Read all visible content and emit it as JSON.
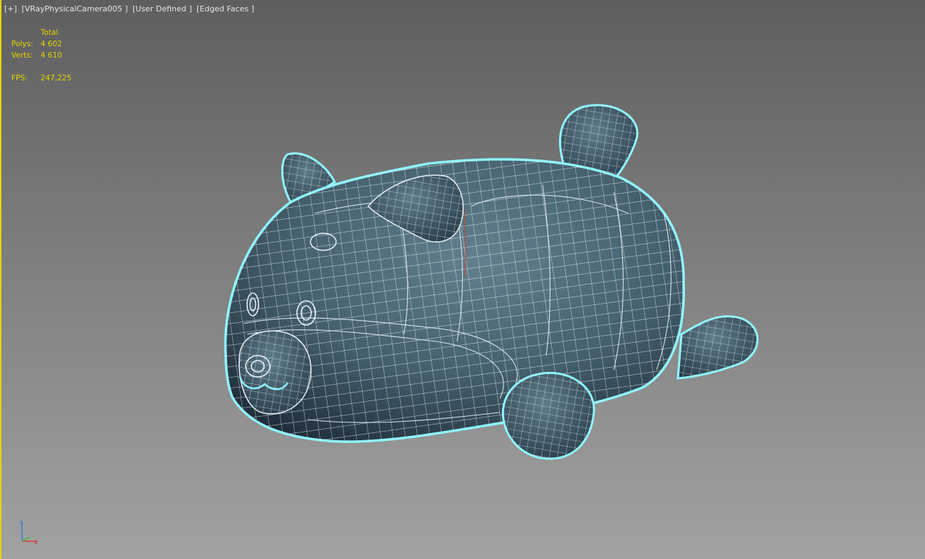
{
  "viewport": {
    "label_parts": [
      "[+]",
      "[VRayPhysicalCamera005 ]",
      "[User Defined ]",
      "[Edged Faces ]"
    ]
  },
  "stats": {
    "header": "Total",
    "polys_label": "Polys:",
    "polys_value": "4 602",
    "verts_label": "Verts:",
    "verts_value": "4 610",
    "fps_label": "FPS:",
    "fps_value": "247,225"
  },
  "axis_gizmo": {
    "z_label": "z",
    "x_label": "x"
  },
  "colors": {
    "selection_outline": "#8ff4ff",
    "wire": "#e8f2f6",
    "mesh_dark": "#243440",
    "mesh_light": "#5d7a88",
    "active_border": "#e8d300",
    "stats_text": "#e9d300"
  }
}
